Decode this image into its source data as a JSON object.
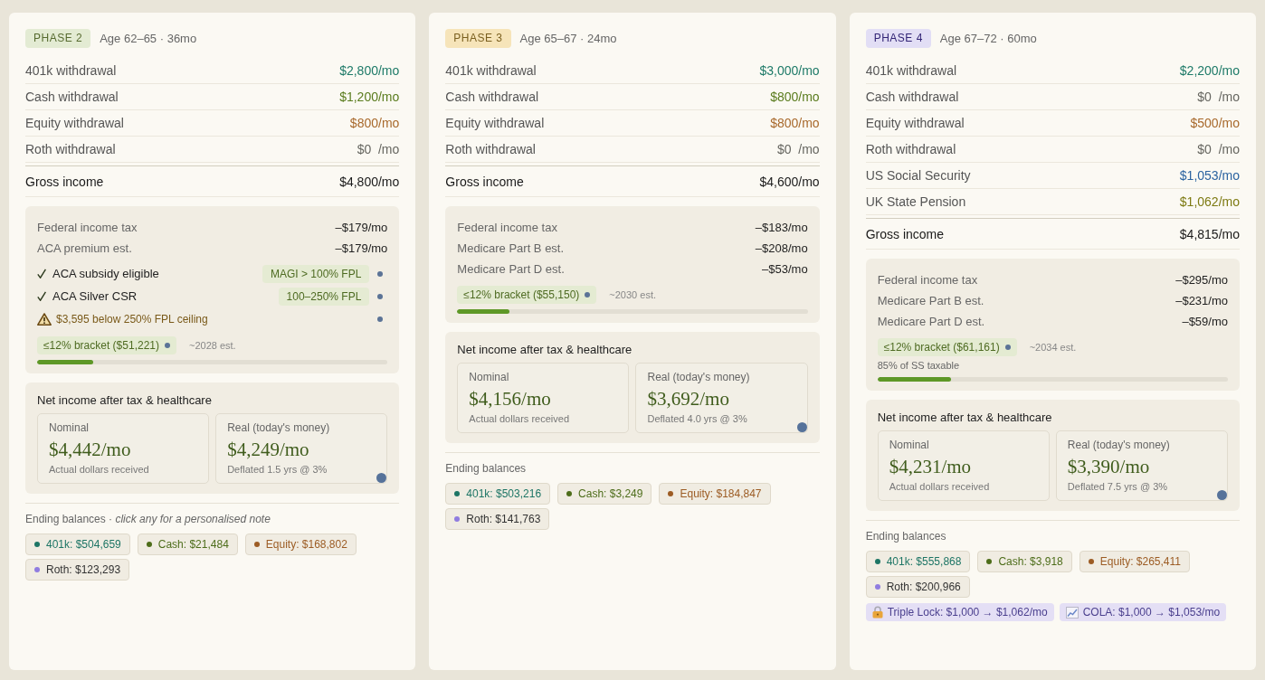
{
  "phases": [
    {
      "badge": {
        "text": "PHASE 2",
        "color": "#e3ebd3"
      },
      "age": "Age 62–65 · 36mo",
      "income": [
        {
          "label": "401k withdrawal",
          "value": "$2,800/mo",
          "color": "#1e7a68"
        },
        {
          "label": "Cash withdrawal",
          "value": "$1,200/mo",
          "color": "#5a7c1e"
        },
        {
          "label": "Equity withdrawal",
          "value": "$800/mo",
          "color": "#a8692c"
        },
        {
          "label": "Roth withdrawal",
          "value": "$0  /mo",
          "color": "#666660"
        }
      ],
      "gross": {
        "label": "Gross income",
        "value": "$4,800/mo"
      },
      "deductions": [
        {
          "kind": "amount",
          "label": "Federal income tax",
          "value": "–$179/mo"
        },
        {
          "kind": "amount",
          "label": "ACA premium est.",
          "value": "–$179/mo"
        },
        {
          "kind": "check",
          "label": "ACA subsidy eligible",
          "tag": "MAGI > 100% FPL"
        },
        {
          "kind": "check",
          "label": "ACA Silver CSR",
          "tag": "100–250% FPL"
        },
        {
          "kind": "warning",
          "label": "$3,595 below 250% FPL ceiling"
        }
      ],
      "bracket": {
        "tag": "≤12% bracket ($51,221)",
        "note": "~2028 est.",
        "level": 0.16
      },
      "net": {
        "title": "Net income after tax & healthcare",
        "boxes": [
          {
            "label": "Nominal",
            "value": "$4,442/mo",
            "sub": "Actual dollars received"
          },
          {
            "label": "Real (today's money)",
            "value": "$4,249/mo",
            "sub": "Deflated 1.5 yrs @ 3%"
          }
        ]
      },
      "balances": {
        "heading": "Ending balances · *click any for a personalised note*",
        "chips": [
          {
            "label": "401k: $504,659",
            "color": "#1d7565",
            "tinted": true
          },
          {
            "label": "Cash: $21,484",
            "color": "#4d6d1a",
            "tinted": true
          },
          {
            "label": "Equity: $168,802",
            "color": "#9c5c24",
            "tinted": true
          },
          {
            "label": "Roth: $123,293",
            "color": "#8f7ce0",
            "tinted": false
          }
        ]
      }
    },
    {
      "badge": {
        "text": "PHASE 3",
        "color": "#f6e4b9"
      },
      "age": "Age 65–67 · 24mo",
      "income": [
        {
          "label": "401k withdrawal",
          "value": "$3,000/mo",
          "color": "#1e7a68"
        },
        {
          "label": "Cash withdrawal",
          "value": "$800/mo",
          "color": "#5a7c1e"
        },
        {
          "label": "Equity withdrawal",
          "value": "$800/mo",
          "color": "#a8692c"
        },
        {
          "label": "Roth withdrawal",
          "value": "$0  /mo",
          "color": "#666660"
        }
      ],
      "gross": {
        "label": "Gross income",
        "value": "$4,600/mo"
      },
      "deductions": [
        {
          "kind": "amount",
          "label": "Federal income tax",
          "value": "–$183/mo"
        },
        {
          "kind": "amount",
          "label": "Medicare Part B est.",
          "value": "–$208/mo"
        },
        {
          "kind": "amount",
          "label": "Medicare Part D est.",
          "value": "–$53/mo"
        }
      ],
      "bracket": {
        "tag": "≤12% bracket ($55,150)",
        "note": "~2030 est.",
        "level": 0.15
      },
      "net": {
        "title": "Net income after tax & healthcare",
        "boxes": [
          {
            "label": "Nominal",
            "value": "$4,156/mo",
            "sub": "Actual dollars received"
          },
          {
            "label": "Real (today's money)",
            "value": "$3,692/mo",
            "sub": "Deflated 4.0 yrs @ 3%"
          }
        ]
      },
      "balances": {
        "heading": "Ending balances",
        "chips": [
          {
            "label": "401k: $503,216",
            "color": "#1d7565",
            "tinted": true
          },
          {
            "label": "Cash: $3,249",
            "color": "#4d6d1a",
            "tinted": true
          },
          {
            "label": "Equity: $184,847",
            "color": "#9c5c24",
            "tinted": true
          },
          {
            "label": "Roth: $141,763",
            "color": "#8f7ce0",
            "tinted": false
          }
        ]
      }
    },
    {
      "badge": {
        "text": "PHASE 4",
        "color": "#e2def5"
      },
      "age": "Age 67–72 · 60mo",
      "income": [
        {
          "label": "401k withdrawal",
          "value": "$2,200/mo",
          "color": "#1e7a68"
        },
        {
          "label": "Cash withdrawal",
          "value": "$0  /mo",
          "color": "#666660"
        },
        {
          "label": "Equity withdrawal",
          "value": "$500/mo",
          "color": "#a8692c"
        },
        {
          "label": "Roth withdrawal",
          "value": "$0  /mo",
          "color": "#666660"
        },
        {
          "label": "US Social Security",
          "value": "$1,053/mo",
          "color": "#2b63a0"
        },
        {
          "label": "UK State Pension",
          "value": "$1,062/mo",
          "color": "#7d7a12"
        }
      ],
      "gross": {
        "label": "Gross income",
        "value": "$4,815/mo"
      },
      "deductions": [
        {
          "kind": "amount",
          "label": "Federal income tax",
          "value": "–$295/mo"
        },
        {
          "kind": "amount",
          "label": "Medicare Part B est.",
          "value": "–$231/mo"
        },
        {
          "kind": "amount",
          "label": "Medicare Part D est.",
          "value": "–$59/mo"
        }
      ],
      "bracket": {
        "tag": "≤12% bracket ($61,161)",
        "note": "~2034 est.",
        "detail": "85% of SS taxable",
        "level": 0.21
      },
      "net": {
        "title": "Net income after tax & healthcare",
        "boxes": [
          {
            "label": "Nominal",
            "value": "$4,231/mo",
            "sub": "Actual dollars received"
          },
          {
            "label": "Real (today's money)",
            "value": "$3,390/mo",
            "sub": "Deflated 7.5 yrs @ 3%"
          }
        ]
      },
      "balances": {
        "heading": "Ending balances",
        "chips": [
          {
            "label": "401k: $555,868",
            "color": "#1d7565",
            "tinted": true
          },
          {
            "label": "Cash: $3,918",
            "color": "#4d6d1a",
            "tinted": true
          },
          {
            "label": "Equity: $265,411",
            "color": "#9c5c24",
            "tinted": true
          },
          {
            "label": "Roth: $200,966",
            "color": "#8f7ce0",
            "tinted": false
          }
        ],
        "notes": [
          {
            "kind": "lock",
            "text": "Triple Lock: $1,000 → $1,062/mo"
          },
          {
            "kind": "trend",
            "text": "COLA: $1,000 → $1,053/mo"
          }
        ]
      }
    }
  ]
}
